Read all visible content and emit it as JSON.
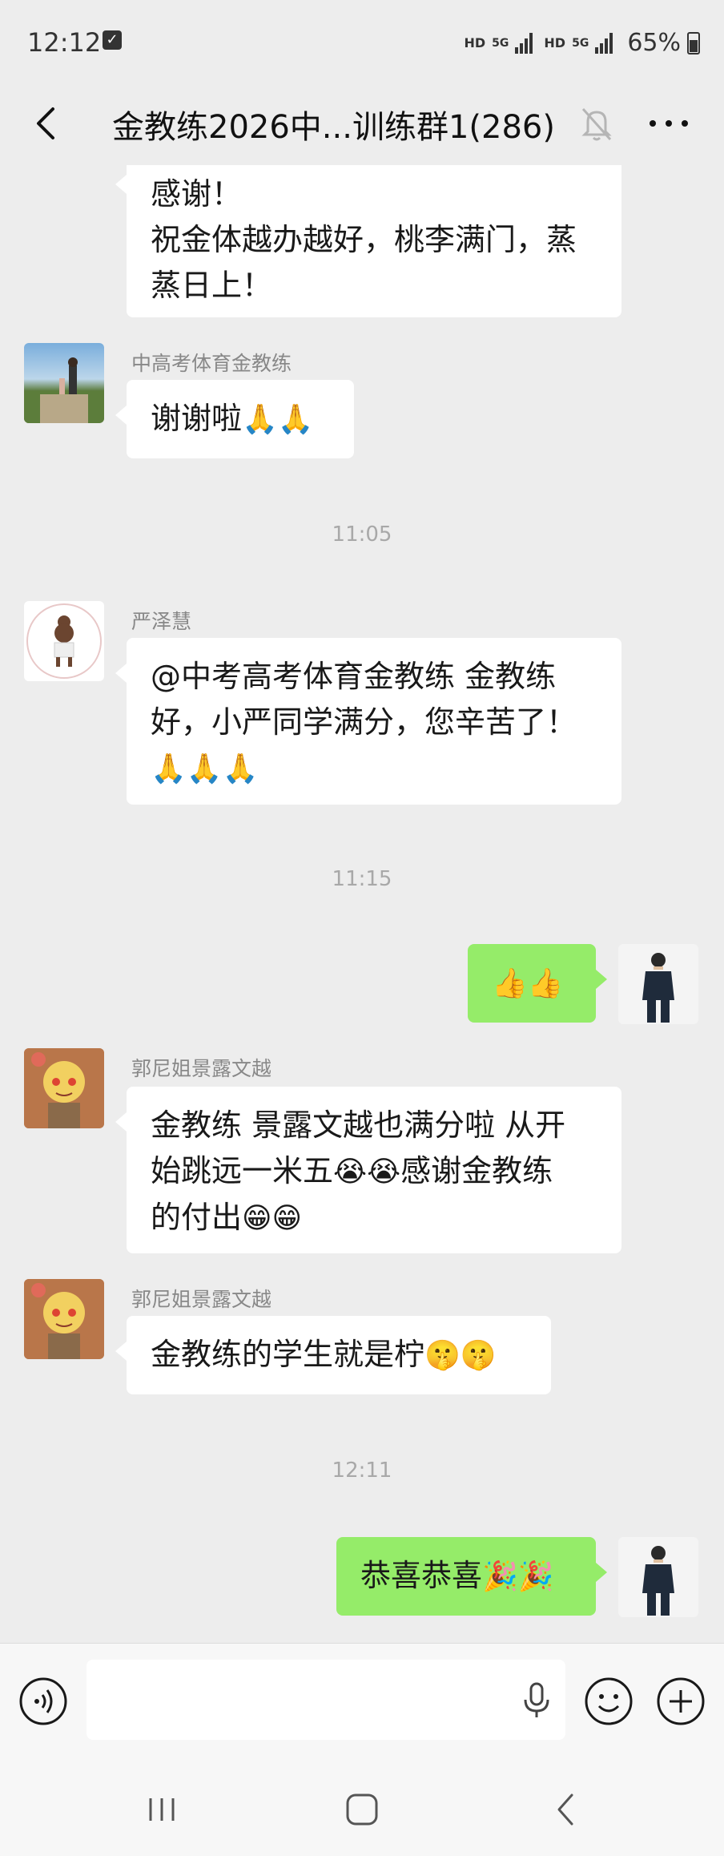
{
  "status_bar": {
    "time": "12:12",
    "net1": "HD",
    "net1_gen": "5G",
    "net2": "HD",
    "net2_gen": "5G",
    "battery": "65%"
  },
  "header": {
    "title": "金教练2026中...训练群1(286)"
  },
  "messages": [
    {
      "line1": "感谢！",
      "line2": "祝金体越办越好，桃李满门，蒸",
      "line3": "蒸日上！"
    },
    {
      "sender": "中高考体育金教练",
      "text": "谢谢啦",
      "emoji": "🙏🙏"
    },
    {
      "time": "11:05"
    },
    {
      "sender": "严泽慧",
      "line1": "@中考高考体育金教练  金教练",
      "line2": "好，小严同学满分，您辛苦了！",
      "emoji": "🙏🙏🙏"
    },
    {
      "time": "11:15"
    },
    {
      "emoji": "👍👍"
    },
    {
      "sender": "郭尼姐景露文越",
      "line1": "金教练 景露文越也满分啦 从开",
      "line2a": "始跳远一米五",
      "line2_emoji": "😭😭",
      "line2b": "感谢金教练",
      "line3": "的付出",
      "line3_emoji": "😁😁"
    },
    {
      "sender": "郭尼姐景露文越",
      "text": "金教练的学生就是柠",
      "emoji": "🤫🤫"
    },
    {
      "time": "12:11"
    },
    {
      "text": "恭喜恭喜",
      "emoji": "🎉🎉"
    }
  ],
  "colors": {
    "background": "#ededed",
    "bubble_self": "#95ec69",
    "bubble_other": "#ffffff"
  },
  "icons": [
    "back-arrow-icon",
    "mute-bell-icon",
    "more-dots-icon",
    "voice-icon",
    "microphone-icon",
    "emoji-icon",
    "plus-icon",
    "nav-recents-icon",
    "nav-home-icon",
    "nav-back-icon"
  ]
}
